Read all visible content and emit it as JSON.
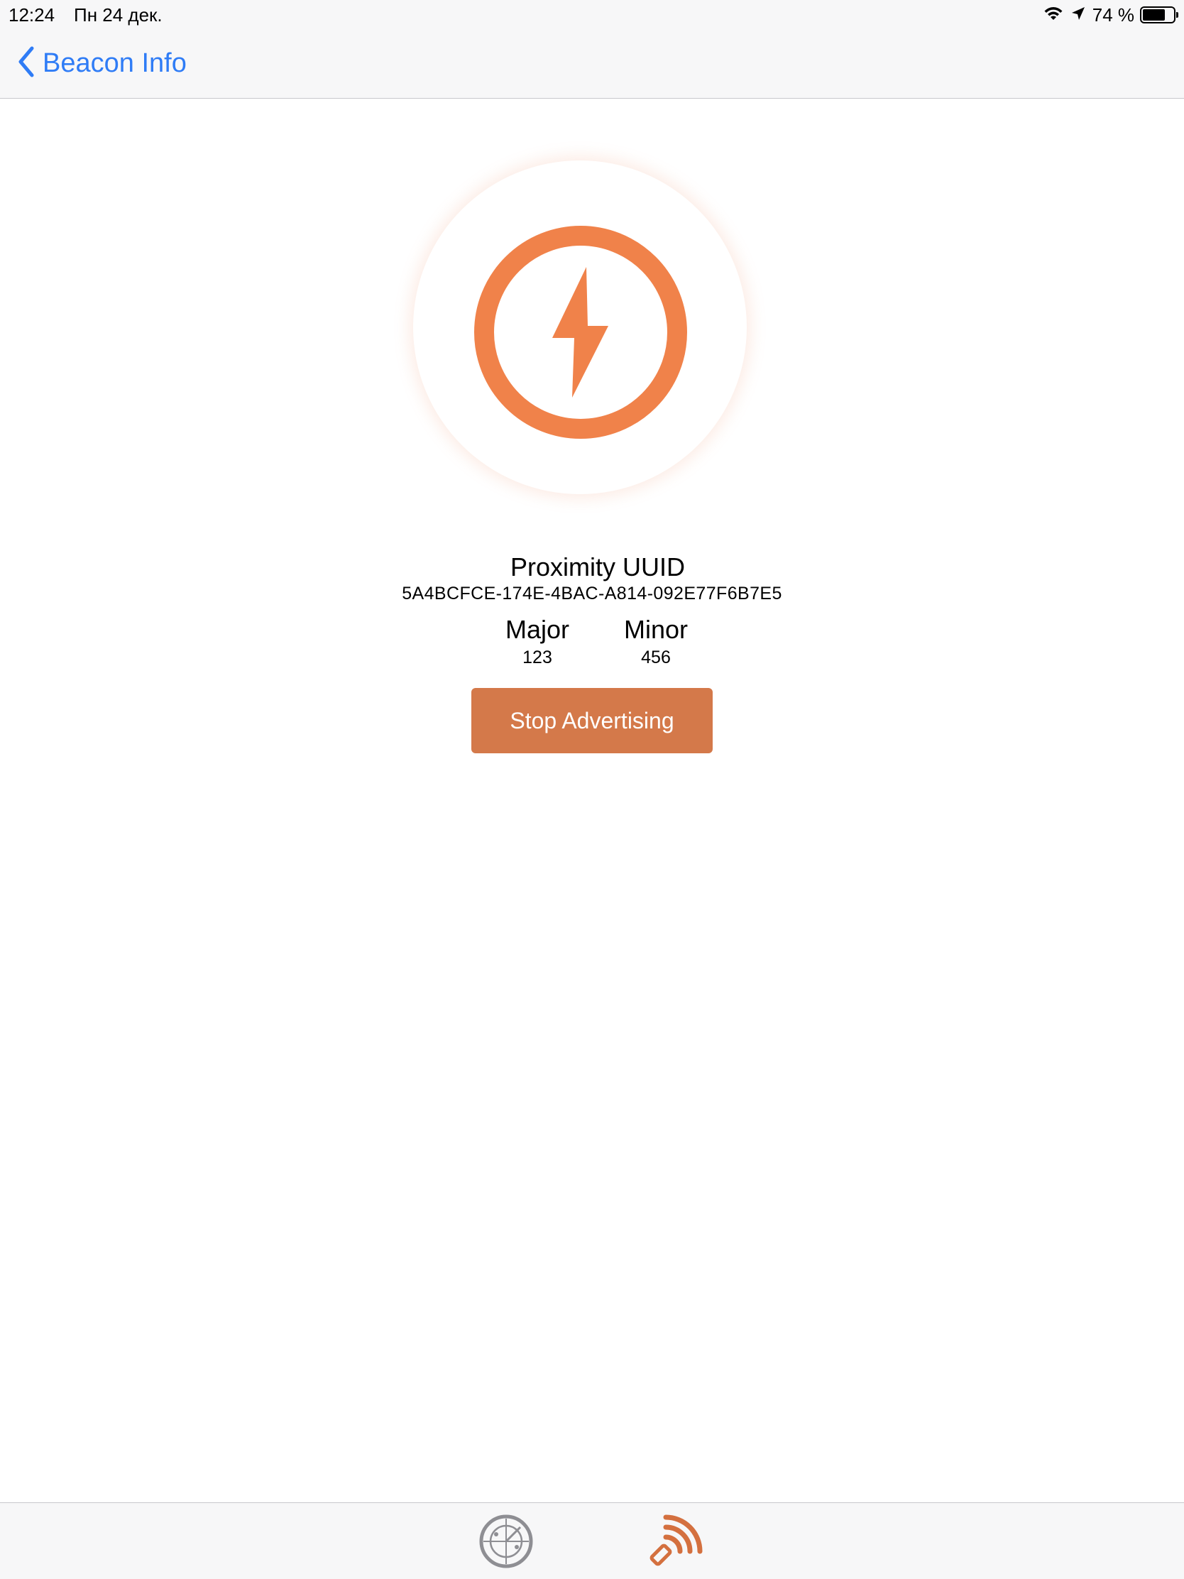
{
  "status_bar": {
    "time": "12:24",
    "date": "Пн 24 дек.",
    "battery_text": "74 %",
    "battery_level_percent": 74,
    "icons": [
      "wifi-icon",
      "location-arrow-icon",
      "battery-icon"
    ]
  },
  "nav": {
    "back_label": "Beacon Info",
    "back_icon": "chevron-left-icon"
  },
  "beacon": {
    "icon": "lightning-bolt-icon",
    "accent_color": "#f0824a"
  },
  "info": {
    "uuid_label": "Proximity UUID",
    "uuid_value": "5A4BCFCE-174E-4BAC-A814-092E77F6B7E5",
    "major_label": "Major",
    "major_value": "123",
    "minor_label": "Minor",
    "minor_value": "456"
  },
  "actions": {
    "stop_label": "Stop Advertising",
    "button_color": "#d4794a"
  },
  "tab_bar": {
    "tabs": [
      {
        "icon": "radar-icon",
        "selected": false
      },
      {
        "icon": "broadcast-icon",
        "selected": true
      }
    ],
    "selected_color": "#d4703f",
    "unselected_color": "#8e8e93"
  },
  "colors": {
    "link": "#2f7cf6",
    "bar_background": "#f7f7f8"
  }
}
